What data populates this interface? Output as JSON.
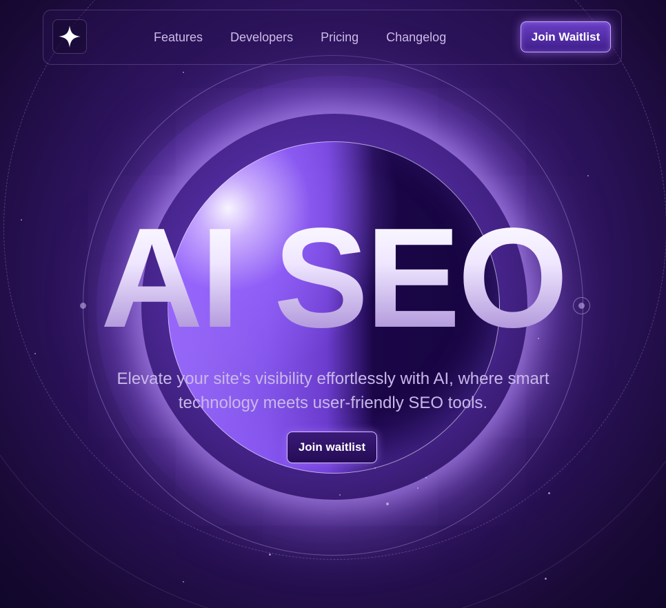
{
  "nav": {
    "logo_icon": "sparkle-icon",
    "links": [
      "Features",
      "Developers",
      "Pricing",
      "Changelog"
    ],
    "cta_label": "Join Waitlist"
  },
  "hero": {
    "headline": "AI SEO",
    "subtitle": "Elevate your site's visibility effortlessly with AI, where smart technology meets user-friendly SEO tools.",
    "cta_label": "Join waitlist"
  },
  "colors": {
    "background": "#2a1258",
    "accent": "#8455ea",
    "text_muted": "#c9b8ea",
    "button_border": "#c9a9ff"
  }
}
